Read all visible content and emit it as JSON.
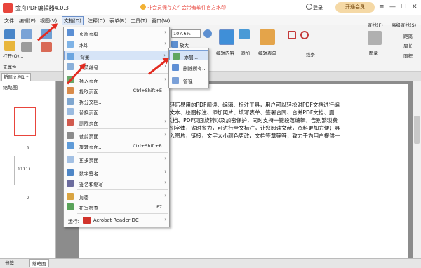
{
  "app": {
    "title": "金舟PDF编辑器4.0.3",
    "notice": "非会员保存文件会带有软件官方水印",
    "login": "登录",
    "vip_button": "开通会员",
    "window_controls": {
      "menu": "≡",
      "minimize": "—",
      "maximize": "☐",
      "close": "✕"
    }
  },
  "menubar": {
    "items": [
      "文件",
      "编辑(E)",
      "视图(V)",
      "文档(D)",
      "注释(C)",
      "表单(R)",
      "工具(T)",
      "窗口(W)"
    ]
  },
  "ribbon": {
    "open_label": "打开(O)...",
    "zoom_value": "107.6%",
    "zoom_in_label": "放大",
    "edit_content_label": "编辑内容",
    "add_label": "添加",
    "edit_form_label": "编辑表单",
    "line_label": "线条",
    "stamp_label": "图章",
    "search_label": "查找(F)",
    "adv_search_label": "高级查找(S)",
    "distance_label": "距离",
    "perimeter_label": "周长",
    "area_label": "面积",
    "props_label": "无属性"
  },
  "document": {
    "tab_label": "新建文档1 *",
    "thumbnails_title": "缩略图",
    "page1_label": "1",
    "page2_label": "2",
    "thumb2_text": "11111",
    "body_lines": [
      "款轻巧易用的PDF阅读、编辑、标注工具，用户可以轻松对PDF文档进行编",
      "编文本、绘图标注、添加照片、填写表单、签署合同、合并PDF文档、删",
      "F文档、PDF页面旋转以及加密保护，同时支持一键段落编辑，告别繁琐费",
      "识别字体，省时省力，可进行全文标注，让您阅读文献，资料更加方便；具",
      "插入图片，链接，文字大小颜色更改，文档签章等等，致力于为用户提供一"
    ]
  },
  "status": {
    "tab_bookmarks": "书签",
    "tab_thumbnails": "缩略图"
  },
  "doc_menu": {
    "items": [
      {
        "label": "页眉页脚",
        "arrow": "›"
      },
      {
        "label": "水印",
        "arrow": "›"
      },
      {
        "label": "背景",
        "arrow": "›"
      },
      {
        "label": "贝茨编号",
        "arrow": "›"
      },
      {
        "label": "插入页面",
        "arrow": "›"
      },
      {
        "label": "提取页面...",
        "shortcut": "Ctrl+Shift+E"
      },
      {
        "label": "拆分文档..."
      },
      {
        "label": "替换页面..."
      },
      {
        "label": "删除页面",
        "arrow": "›"
      },
      {
        "label": "裁剪页面",
        "arrow": "›"
      },
      {
        "label": "旋转页面...",
        "shortcut": "Ctrl+Shift+R"
      },
      {
        "label": "更多页面",
        "arrow": "›"
      },
      {
        "label": "数字签名",
        "arrow": "›"
      },
      {
        "label": "签名和缩写",
        "arrow": "›"
      },
      {
        "label": "加密",
        "arrow": "›"
      },
      {
        "label": "拼写检查",
        "shortcut": "F7"
      },
      {
        "label": "运行:",
        "extra": "Acrobat Reader DC",
        "arrow": "›"
      }
    ]
  },
  "background_submenu": {
    "items": [
      {
        "label": "添加..."
      },
      {
        "label": "删除所有..."
      },
      {
        "label": "管理..."
      }
    ]
  },
  "colors": {
    "accent_red": "#e32b20",
    "highlight": "#d6e4f7"
  }
}
